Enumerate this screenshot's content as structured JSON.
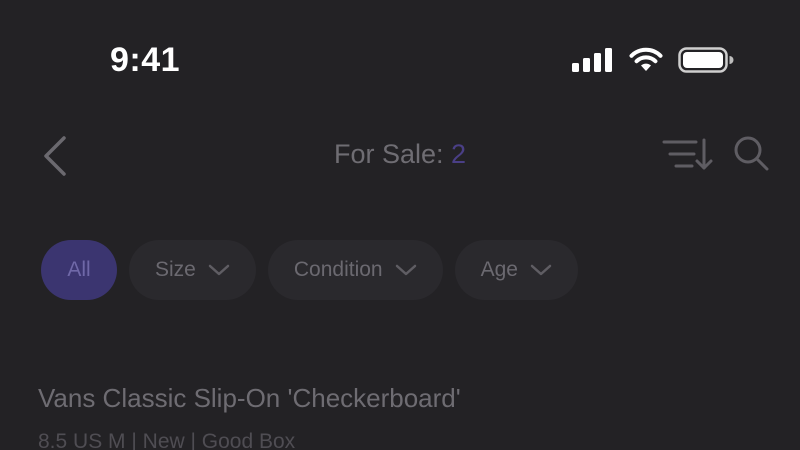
{
  "status_bar": {
    "time": "9:41",
    "icons": [
      "cellular-signal-icon",
      "wifi-icon",
      "battery-icon"
    ]
  },
  "header": {
    "title_label": "For Sale:",
    "title_count": "2",
    "back_icon": "chevron-left-icon",
    "sort_icon": "sort-icon",
    "search_icon": "search-icon"
  },
  "filters": {
    "chips": [
      {
        "label": "All",
        "active": true
      },
      {
        "label": "Size",
        "active": false
      },
      {
        "label": "Condition",
        "active": false
      },
      {
        "label": "Age",
        "active": false
      }
    ]
  },
  "listing": {
    "title": "Vans Classic Slip-On 'Checkerboard'",
    "meta": "8.5 US M | New | Good Box"
  },
  "colors": {
    "background": "#232225",
    "accent": "#3b3570",
    "count_accent": "#4a3f86"
  }
}
